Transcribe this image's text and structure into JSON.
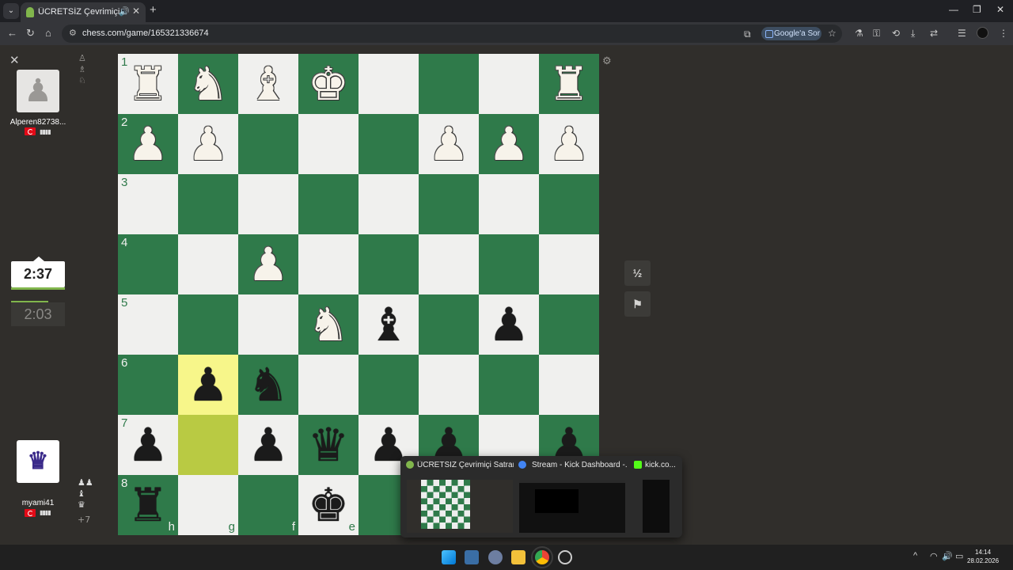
{
  "browser": {
    "tab_title": "ÜCRETSİZ Çevrimiçi Satranç",
    "url": "chess.com/game/165321336674",
    "ask_google": "Google'a Sor"
  },
  "players": {
    "top": {
      "name": "Alperen82738...",
      "clock": "2:03"
    },
    "bottom": {
      "name": "myami41",
      "clock": "2:37",
      "material": "+7"
    }
  },
  "board": {
    "files": [
      "h",
      "g",
      "f",
      "e",
      "d",
      "c",
      "b",
      "a"
    ],
    "ranks": [
      "1",
      "2",
      "3",
      "4",
      "5",
      "6",
      "7",
      "8"
    ],
    "highlight_colors": {
      "from": "#f7f68a",
      "to": "#b9ca43"
    },
    "pieces": [
      {
        "sq": "h1",
        "p": "♜",
        "c": "w"
      },
      {
        "sq": "g1",
        "p": "♞",
        "c": "w"
      },
      {
        "sq": "f1",
        "p": "♝",
        "c": "w"
      },
      {
        "sq": "e1",
        "p": "♚",
        "c": "w"
      },
      {
        "sq": "a1",
        "p": "♜",
        "c": "w"
      },
      {
        "sq": "h2",
        "p": "♟",
        "c": "w"
      },
      {
        "sq": "g2",
        "p": "♟",
        "c": "w"
      },
      {
        "sq": "c2",
        "p": "♟",
        "c": "w"
      },
      {
        "sq": "b2",
        "p": "♟",
        "c": "w"
      },
      {
        "sq": "a2",
        "p": "♟",
        "c": "w"
      },
      {
        "sq": "f4",
        "p": "♟",
        "c": "w"
      },
      {
        "sq": "e5",
        "p": "♞",
        "c": "w"
      },
      {
        "sq": "d5",
        "p": "♝",
        "c": "b"
      },
      {
        "sq": "b5",
        "p": "♟",
        "c": "b"
      },
      {
        "sq": "g6",
        "p": "♟",
        "c": "b"
      },
      {
        "sq": "f6",
        "p": "♞",
        "c": "b"
      },
      {
        "sq": "h7",
        "p": "♟",
        "c": "b"
      },
      {
        "sq": "f7",
        "p": "♟",
        "c": "b"
      },
      {
        "sq": "e7",
        "p": "♛",
        "c": "b"
      },
      {
        "sq": "d7",
        "p": "♟",
        "c": "b"
      },
      {
        "sq": "c7",
        "p": "♟",
        "c": "b"
      },
      {
        "sq": "a7",
        "p": "♟",
        "c": "b"
      },
      {
        "sq": "h8",
        "p": "♜",
        "c": "b"
      },
      {
        "sq": "e8",
        "p": "♚",
        "c": "b"
      }
    ]
  },
  "controls": {
    "draw": "½",
    "resign": "⚑"
  },
  "previews": [
    {
      "title": "ÜCRETSİZ Çevrimiçi Satranç...",
      "color": "#81b64c"
    },
    {
      "title": "Stream - Kick Dashboard -...",
      "color": "#4285f4"
    },
    {
      "title": "kick.co...",
      "color": "#53fc18"
    }
  ],
  "system": {
    "time": "14:14",
    "date": "28.02.2026"
  }
}
